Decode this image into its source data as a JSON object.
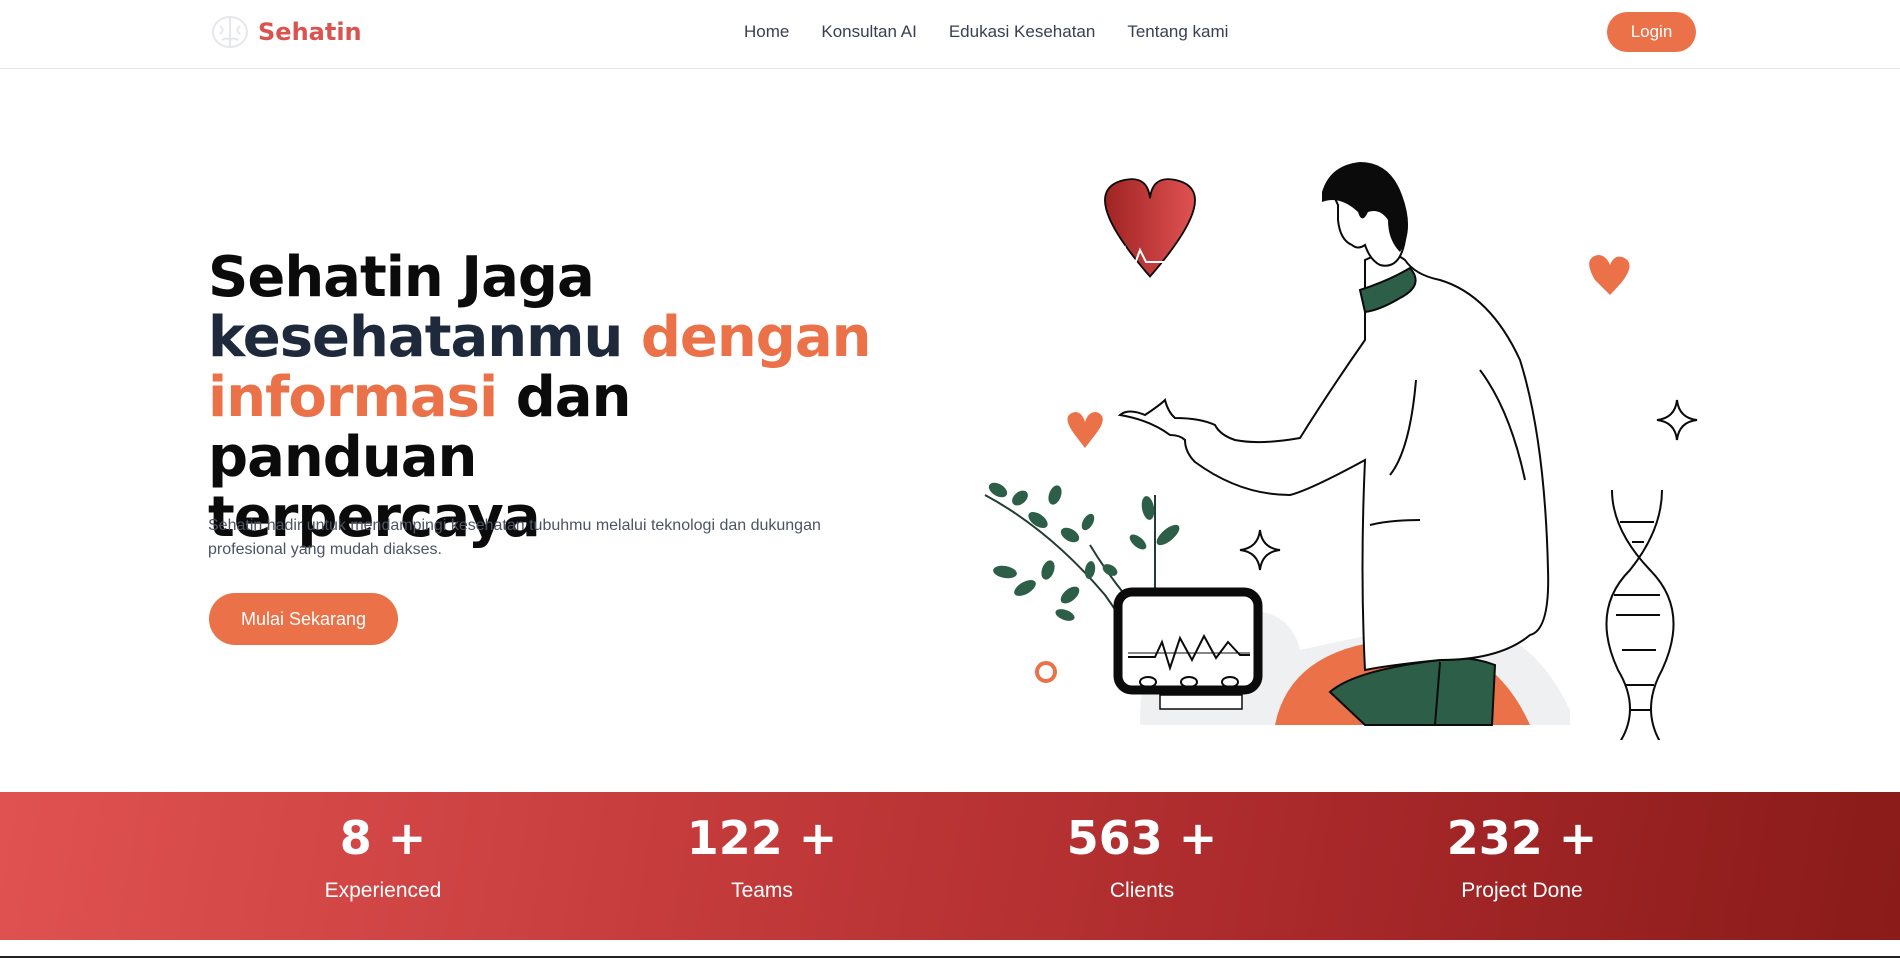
{
  "nav": {
    "brand": "Sehatin",
    "links": [
      "Home",
      "Konsultan AI",
      "Edukasi Kesehatan",
      "Tentang kami"
    ],
    "login": "Login"
  },
  "hero": {
    "title_line1": "Sehatin Jaga",
    "title_word_dark": "kesehatanmu",
    "title_word_accent1": "dengan",
    "title_word_accent2": "informasi",
    "title_rest": "dan panduan",
    "title_line4": "terpercaya",
    "description": "Sehatin hadir untuk mendampingi kesehatan tubuhmu melalui teknologi dan dukungan profesional yang mudah diakses.",
    "cta": "Mulai Sekarang"
  },
  "stats": [
    {
      "value": "8 +",
      "label": "Experienced"
    },
    {
      "value": "122 +",
      "label": "Teams"
    },
    {
      "value": "563 +",
      "label": "Clients"
    },
    {
      "value": "232 +",
      "label": "Project Done"
    }
  ],
  "colors": {
    "accent": "#ea7148",
    "brand": "#d9534f",
    "heart": "#b52a2a",
    "leaf": "#2d5e48",
    "stats_start": "#e05252",
    "stats_end": "#891b18"
  },
  "icons": [
    "brain-logo-icon",
    "heart-monitor-icon",
    "dna-icon",
    "sparkle-icon"
  ]
}
